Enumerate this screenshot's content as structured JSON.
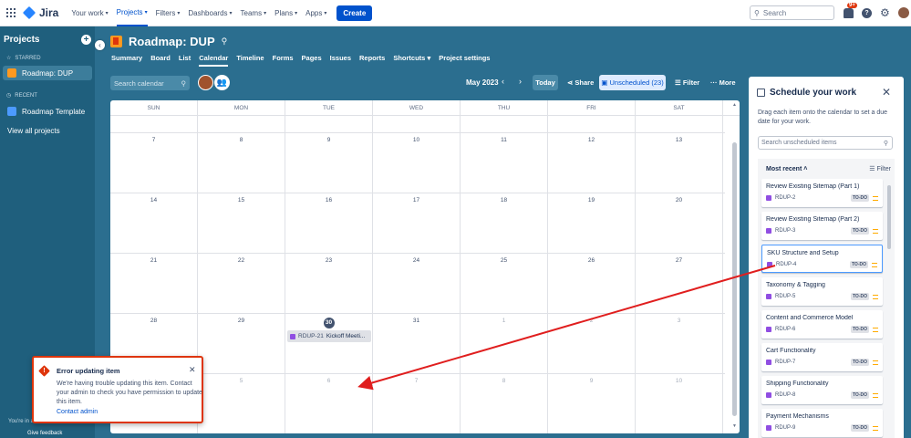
{
  "topnav": {
    "logo": "Jira",
    "items": [
      "Your work",
      "Projects",
      "Filters",
      "Dashboards",
      "Teams",
      "Plans",
      "Apps"
    ],
    "create_label": "Create",
    "search_placeholder": "Search",
    "notification_badge": "9+"
  },
  "sidebar": {
    "title": "Projects",
    "starred_label": "STARRED",
    "starred_project": "Roadmap: DUP",
    "recent_label": "RECENT",
    "recent_project": "Roadmap Template",
    "view_all": "View all projects",
    "footer_text": "You're in a",
    "feedback": "Give feedback"
  },
  "project": {
    "title": "Roadmap: DUP",
    "tabs": [
      "Summary",
      "Board",
      "List",
      "Calendar",
      "Timeline",
      "Forms",
      "Pages",
      "Issues",
      "Reports",
      "Shortcuts",
      "Project settings"
    ],
    "active_tab": "Calendar"
  },
  "toolbar": {
    "search_placeholder": "Search calendar",
    "month": "May 2023",
    "today": "Today",
    "share": "Share",
    "unscheduled": "Unscheduled (23)",
    "filter": "Filter",
    "more": "More"
  },
  "calendar": {
    "weekdays": [
      "SUN",
      "MON",
      "TUE",
      "WED",
      "THU",
      "FRI",
      "SAT"
    ],
    "rows": [
      [
        "",
        "",
        "",
        "",
        "",
        "",
        ""
      ],
      [
        "7",
        "8",
        "9",
        "10",
        "11",
        "12",
        "13"
      ],
      [
        "14",
        "15",
        "16",
        "17",
        "18",
        "19",
        "20"
      ],
      [
        "21",
        "22",
        "23",
        "24",
        "25",
        "26",
        "27"
      ],
      [
        "28",
        "29",
        "30",
        "31",
        "1",
        "2",
        "3"
      ],
      [
        "",
        "5",
        "6",
        "7",
        "8",
        "9",
        "10"
      ]
    ],
    "today": "30",
    "event": {
      "key": "RDUP-21",
      "title": "Kickoff Meeti..."
    }
  },
  "panel": {
    "title": "Schedule your work",
    "description": "Drag each item onto the calendar to set a due date for your work.",
    "search_placeholder": "Search unscheduled items",
    "sort_label": "Most recent",
    "filter_label": "Filter",
    "items": [
      {
        "title": "Review Existing Sitemap (Part 1)",
        "key": "RDUP-2",
        "status": "TO-DO"
      },
      {
        "title": "Review Existing Sitemap (Part 2)",
        "key": "RDUP-3",
        "status": "TO-DO"
      },
      {
        "title": "SKU Structure and Setup",
        "key": "RDUP-4",
        "status": "TO-DO"
      },
      {
        "title": "Taxonomy & Tagging",
        "key": "RDUP-5",
        "status": "TO-DO"
      },
      {
        "title": "Content and Commerce Model",
        "key": "RDUP-6",
        "status": "TO-DO"
      },
      {
        "title": "Cart Functionality",
        "key": "RDUP-7",
        "status": "TO-DO"
      },
      {
        "title": "Shipping Functionality",
        "key": "RDUP-8",
        "status": "TO-DO"
      },
      {
        "title": "Payment Mechanisms",
        "key": "RDUP-9",
        "status": "TO-DO"
      }
    ]
  },
  "error": {
    "title": "Error updating item",
    "message": "We're having trouble updating this item. Contact your admin to check you have permission to update this item.",
    "link": "Contact admin"
  },
  "colors": {
    "accent": "#0052cc",
    "background": "#2b6e8f",
    "error": "#de350b",
    "annotation": "#e01e1e"
  }
}
